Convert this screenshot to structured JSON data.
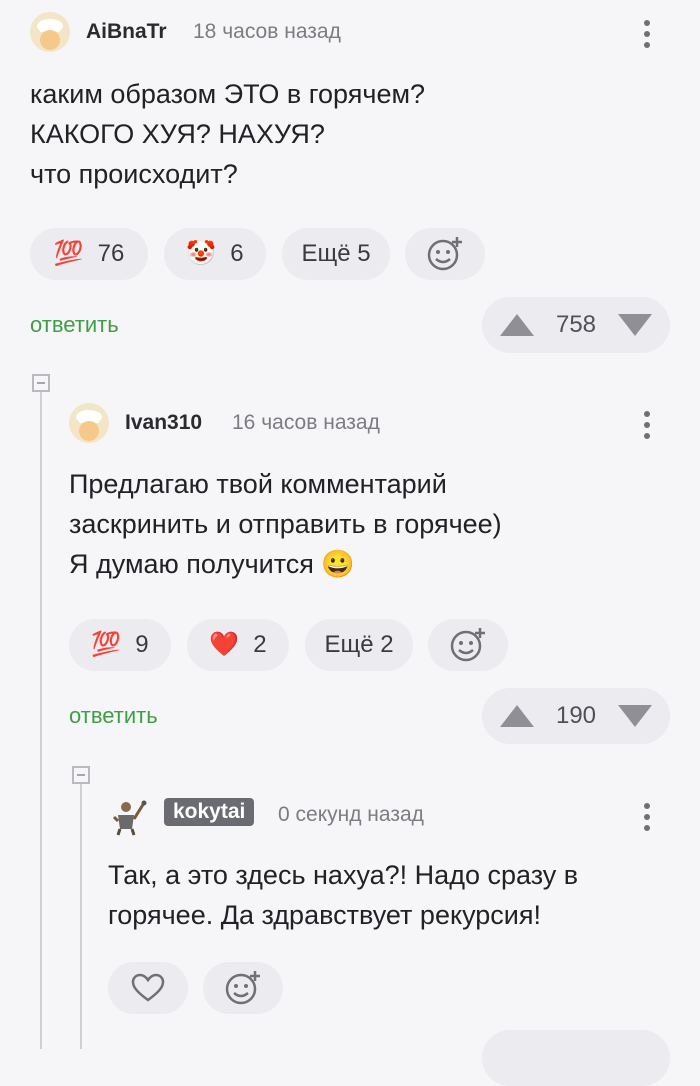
{
  "comment1": {
    "username": "AiBnaTr",
    "time": "18 часов назад",
    "lines": [
      "каким образом ЭТО в горячем?",
      "КАКОГО ХУЯ? НАХУЯ?",
      "что происходит?"
    ],
    "reactions": [
      {
        "emoji": "💯",
        "count": "76"
      },
      {
        "emoji": "🤡",
        "count": "6"
      }
    ],
    "more": "Ещё 5",
    "reply": "ответить",
    "rating": "758"
  },
  "comment2": {
    "username": "Ivan310",
    "time": "16 часов назад",
    "lines": [
      "Предлагаю твой комментарий",
      "заскринить и отправить в горячее)",
      "Я думаю получится 😀"
    ],
    "reactions": [
      {
        "emoji": "💯",
        "count": "9"
      },
      {
        "emoji": "❤️",
        "count": "2"
      }
    ],
    "more": "Ещё 2",
    "reply": "ответить",
    "rating": "190"
  },
  "comment3": {
    "username": "kokytai",
    "time": "0 секунд назад",
    "lines": [
      "Так, а это здесь нахуа?! Надо сразу в",
      "горячее. Да здравствует рекурсия!"
    ]
  },
  "colors": {
    "reply": "#3f9e45",
    "badge": "#6b6b72",
    "heart": "#e0243a"
  }
}
